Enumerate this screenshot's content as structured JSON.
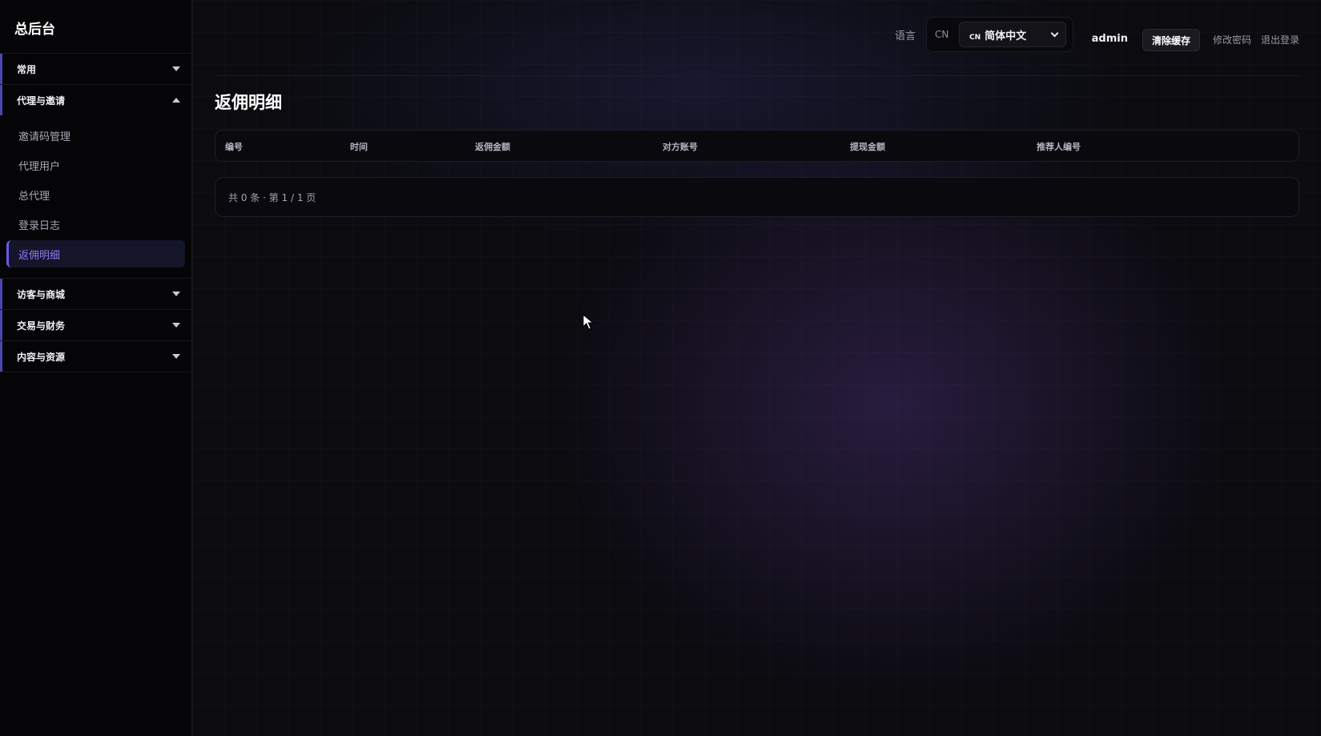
{
  "sidebar": {
    "brand": "总后台",
    "groups": [
      {
        "label": "常用",
        "expanded": false
      },
      {
        "label": "代理与邀请",
        "expanded": true,
        "items": [
          {
            "label": "邀请码管理"
          },
          {
            "label": "代理用户"
          },
          {
            "label": "总代理"
          },
          {
            "label": "登录日志"
          },
          {
            "label": "返佣明细",
            "active": true
          }
        ]
      },
      {
        "label": "访客与商城",
        "expanded": false
      },
      {
        "label": "交易与财务",
        "expanded": false
      },
      {
        "label": "内容与资源",
        "expanded": false
      }
    ]
  },
  "topbar": {
    "language_label": "语言",
    "language_code": "CN",
    "language_flag": "CN",
    "language_selected": "简体中文",
    "username": "admin",
    "clear_cache_label": "清除缓存",
    "change_password_label": "修改密码",
    "logout_label": "退出登录"
  },
  "page": {
    "title": "返佣明细",
    "columns": [
      "编号",
      "时间",
      "返佣金额",
      "对方账号",
      "提现金额",
      "推荐人编号"
    ],
    "pager_text": "共 0 条 · 第 1 / 1 页"
  },
  "colors": {
    "accent": "#6b5ae6",
    "active_text": "#8a7cf0",
    "background": "#0b0b10"
  }
}
